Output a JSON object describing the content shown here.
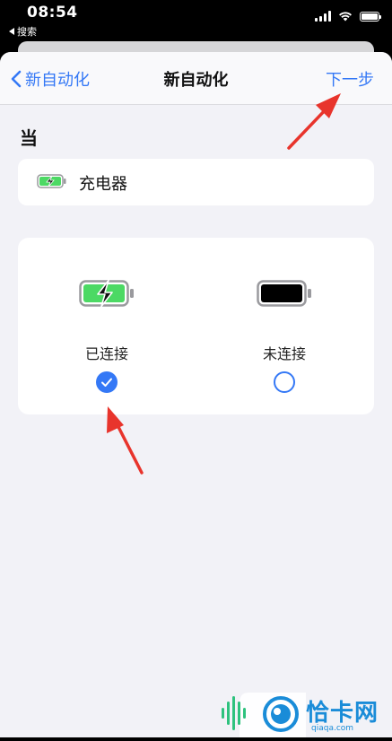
{
  "status_bar": {
    "time": "08:54",
    "back_label": "搜索"
  },
  "nav": {
    "back_label": "新自动化",
    "title": "新自动化",
    "next_label": "下一步"
  },
  "section": {
    "label": "当"
  },
  "trigger": {
    "label": "充电器",
    "icon": "charging-battery-icon"
  },
  "options": [
    {
      "label": "已连接",
      "icon": "charging-battery-icon",
      "selected": true
    },
    {
      "label": "未连接",
      "icon": "battery-full-icon",
      "selected": false
    }
  ],
  "colors": {
    "accent": "#3478f6",
    "battery_green": "#4cd964",
    "annotation_red": "#e8342c",
    "background": "#f2f2f7"
  },
  "watermark": {
    "text": "恰卡网",
    "sub": "qiaqa.com"
  }
}
